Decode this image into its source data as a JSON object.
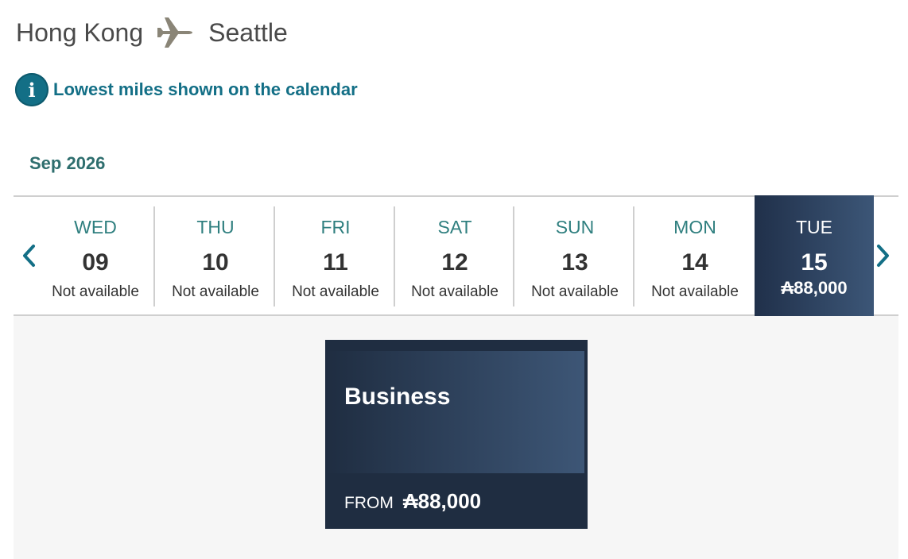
{
  "route": {
    "origin": "Hong Kong",
    "destination": "Seattle",
    "icon": "airplane-icon"
  },
  "notice": {
    "icon": "info-icon",
    "icon_glyph": "i",
    "text": "Lowest miles shown on the calendar"
  },
  "calendar": {
    "month_label": "Sep 2026",
    "prev_icon": "chevron-left-icon",
    "next_icon": "chevron-right-icon",
    "days": [
      {
        "dow": "WED",
        "day": "09",
        "status": "Not available"
      },
      {
        "dow": "THU",
        "day": "10",
        "status": "Not available"
      },
      {
        "dow": "FRI",
        "day": "11",
        "status": "Not available"
      },
      {
        "dow": "SAT",
        "day": "12",
        "status": "Not available"
      },
      {
        "dow": "SUN",
        "day": "13",
        "status": "Not available"
      },
      {
        "dow": "MON",
        "day": "14",
        "status": "Not available"
      },
      {
        "dow": "TUE",
        "day": "15",
        "status": "₳88,000",
        "selected": true
      }
    ]
  },
  "fare_card": {
    "cabin": "Business",
    "from_label": "FROM",
    "price": "₳88,000"
  },
  "colors": {
    "accent_teal": "#136f86",
    "navy_dark": "#1f2d41",
    "navy_light": "#3d5676",
    "panel_bg": "#f6f6f6"
  }
}
